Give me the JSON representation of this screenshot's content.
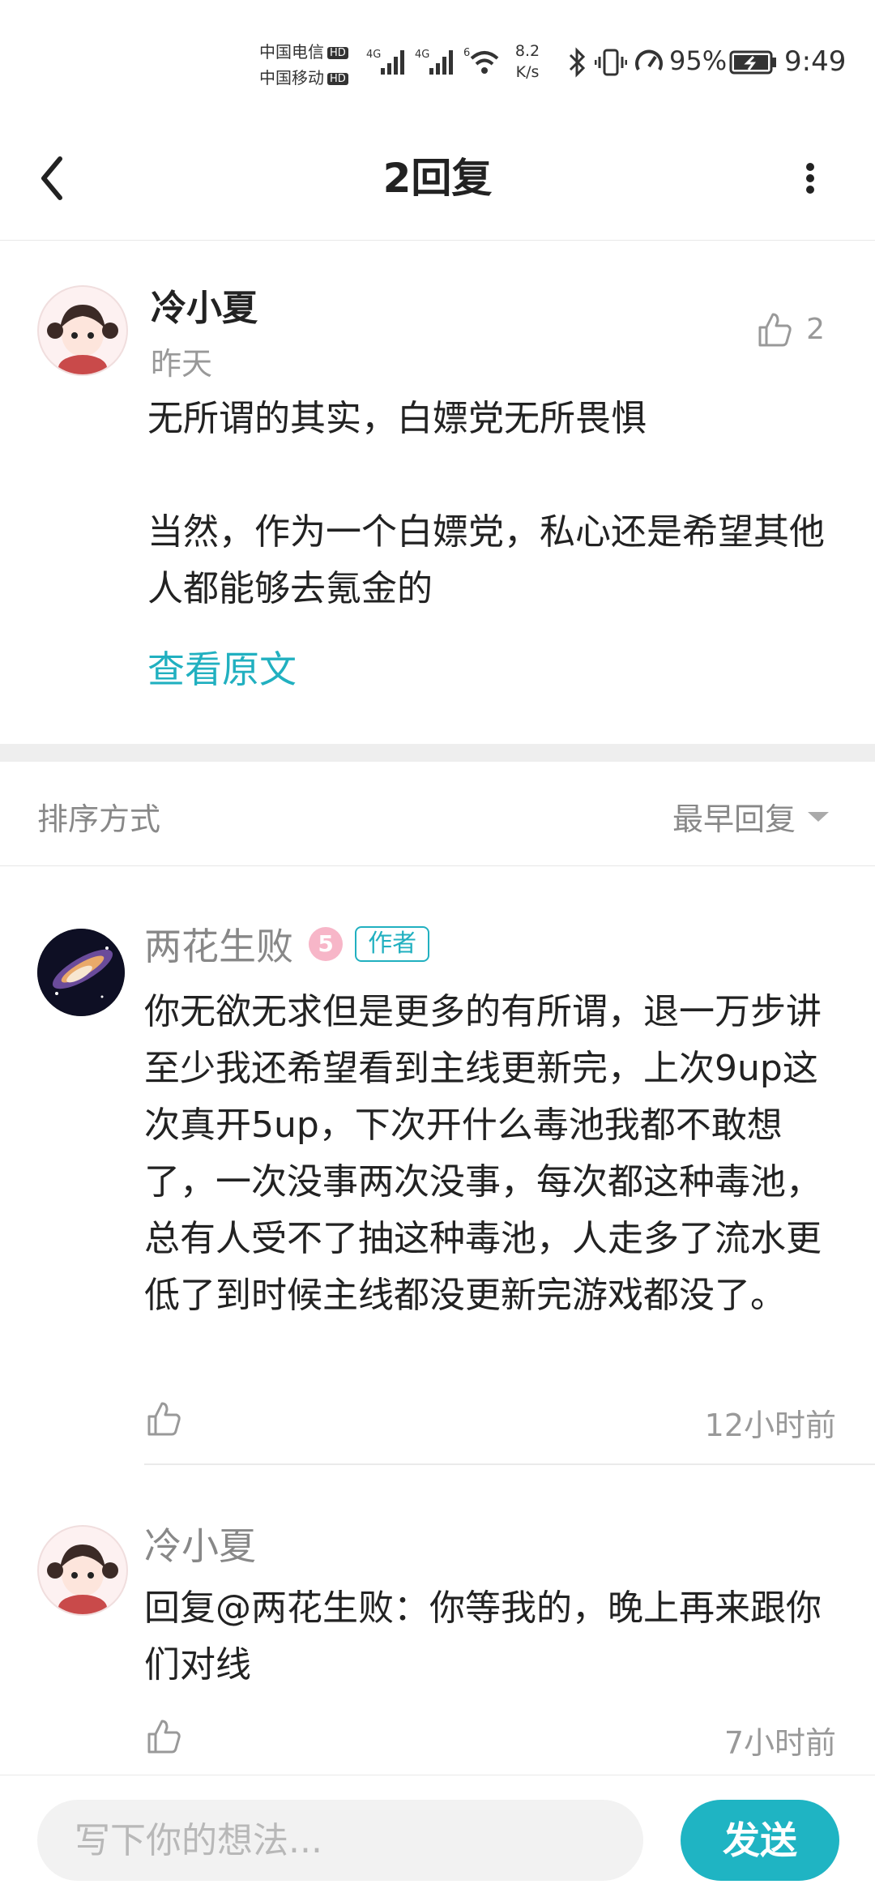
{
  "status_bar": {
    "carrier_1": "中国电信",
    "carrier_2": "中国移动",
    "hd": "HD",
    "net_1": "4G",
    "net_2": "4G",
    "net_3": "6",
    "speed_value": "8.2",
    "speed_unit": "K/s",
    "battery": "95%",
    "time": "9:49"
  },
  "header": {
    "title": "2回复"
  },
  "main_post": {
    "username": "冷小夏",
    "time": "昨天",
    "like_count": "2",
    "text": "无所谓的其实，白嫖党无所畏惧\n\n当然，作为一个白嫖党，私心还是希望其他人都能够去氪金的",
    "view_original": "查看原文"
  },
  "sort": {
    "label": "排序方式",
    "value": "最早回复"
  },
  "replies": [
    {
      "username": "两花生败",
      "level_badge": "5",
      "author_badge": "作者",
      "text": "你无欲无求但是更多的有所谓，退一万步讲至少我还希望看到主线更新完，上次9up这次真开5up，下次开什么毒池我都不敢想了，一次没事两次没事，每次都这种毒池，总有人受不了抽这种毒池，人走多了流水更低了到时候主线都没更新完游戏都没了。",
      "time": "12小时前"
    },
    {
      "username": "冷小夏",
      "text": "回复@两花生败：你等我的，晚上再来跟你们对线",
      "time": "7小时前"
    }
  ],
  "composer": {
    "placeholder": "写下你的想法...",
    "send_label": "发送"
  },
  "colors": {
    "accent": "#1fb4c3",
    "link": "#21b0c0"
  }
}
